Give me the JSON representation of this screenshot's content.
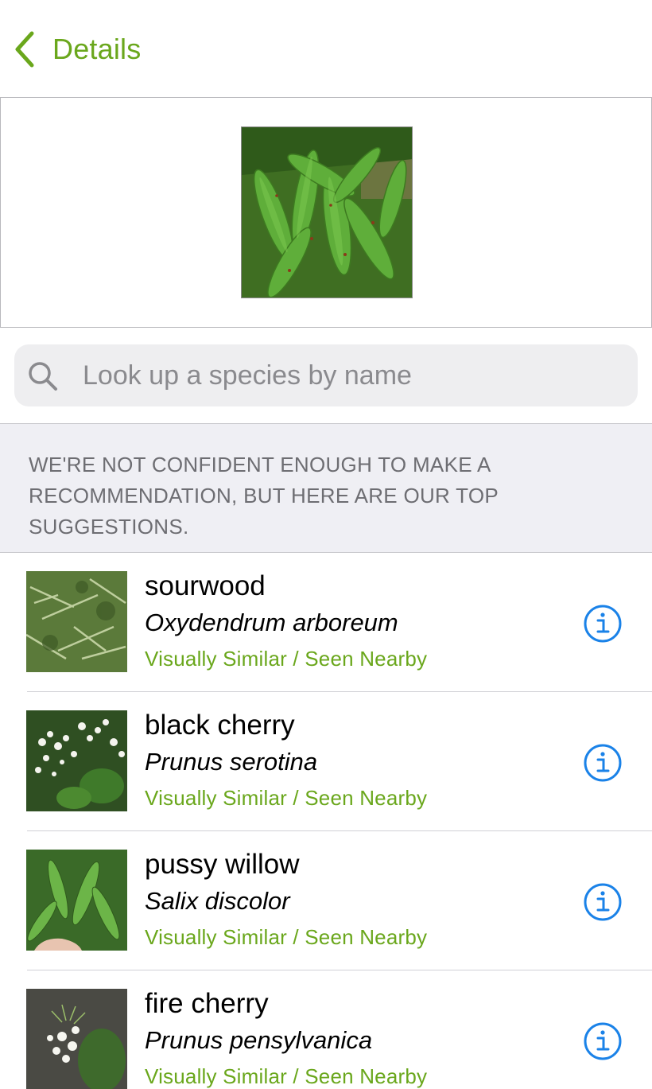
{
  "nav": {
    "back_label": "Details"
  },
  "search": {
    "placeholder": "Look up a species by name"
  },
  "notice": {
    "text": "WE'RE NOT CONFIDENT ENOUGH TO MAKE A RECOMMENDATION, BUT HERE ARE OUR TOP SUGGESTIONS."
  },
  "suggestions": [
    {
      "common_name": "sourwood",
      "scientific_name": "Oxydendrum arboreum",
      "reason": "Visually Similar / Seen Nearby"
    },
    {
      "common_name": "black cherry",
      "scientific_name": "Prunus serotina",
      "reason": "Visually Similar / Seen Nearby"
    },
    {
      "common_name": "pussy willow",
      "scientific_name": "Salix discolor",
      "reason": "Visually Similar / Seen Nearby"
    },
    {
      "common_name": "fire cherry",
      "scientific_name": "Prunus pensylvanica",
      "reason": "Visually Similar / Seen Nearby"
    }
  ],
  "colors": {
    "accent_green": "#6aa71c",
    "info_blue": "#1a82e8",
    "notice_bg": "#efeff4"
  },
  "icons": {
    "back": "chevron-left-icon",
    "search": "search-icon",
    "info": "info-circle-icon"
  }
}
